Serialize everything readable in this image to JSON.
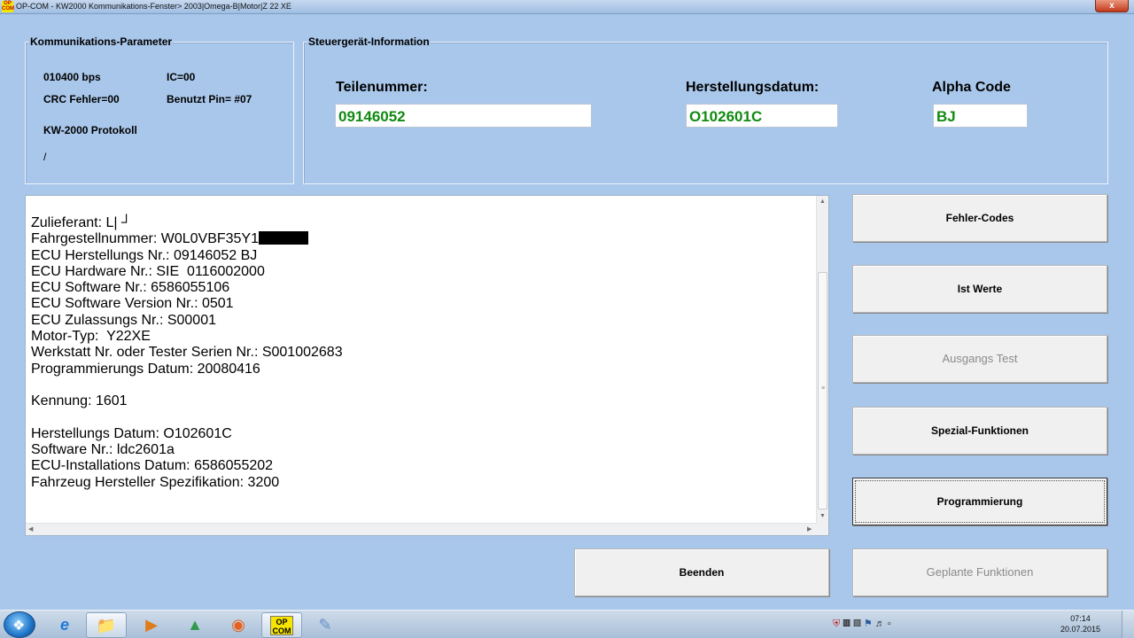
{
  "window": {
    "icon_text": "OP COM",
    "title": "OP-COM - KW2000 Kommunikations-Fenster> 2003|Omega-B|Motor|Z 22 XE",
    "close_label": "x"
  },
  "comm_params": {
    "legend": "Kommunikations-Parameter",
    "baud": "010400 bps",
    "ic": "IC=00",
    "crc": "CRC Fehler=00",
    "pin": "Benutzt Pin= #07",
    "protocol": "KW-2000 Protokoll",
    "slash": "/"
  },
  "ecu_info": {
    "legend": "Steuergerät-Information",
    "part_label": "Teilenummer:",
    "part_value": "09146052",
    "date_label": "Herstellungsdatum:",
    "date_value": "O102601C",
    "alpha_label": "Alpha Code",
    "alpha_value": "BJ"
  },
  "info": {
    "lines": [
      "Zulieferant: L| ┘",
      "Fahrgestellnummer: W0L0VBF35Y1",
      "ECU Herstellungs Nr.: 09146052 BJ",
      "ECU Hardware Nr.: SIE  0116002000",
      "ECU Software Nr.: 6586055106",
      "ECU Software Version Nr.: 0501",
      "ECU Zulassungs Nr.: S00001",
      "Motor-Typ:  Y22XE",
      "Werkstatt Nr. oder Tester Serien Nr.: S001002683",
      "Programmierungs Datum: 20080416",
      "",
      "Kennung: 1601",
      "",
      "Herstellungs Datum: O102601C",
      "Software Nr.: ldc2601a",
      "ECU-Installations Datum: 6586055202",
      "Fahrzeug Hersteller Spezifikation: 3200"
    ]
  },
  "buttons": {
    "fehler_codes": "Fehler-Codes",
    "ist_werte": "Ist Werte",
    "ausgangs_test": "Ausgangs Test",
    "spezial_funktionen": "Spezial-Funktionen",
    "programmierung": "Programmierung",
    "beenden": "Beenden",
    "geplante_funktionen": "Geplante Funktionen"
  },
  "taskbar": {
    "opcom_label": "OP COM",
    "tray_icons": [
      "shield-icon",
      "windows-flag-icon",
      "network-icon",
      "volume-icon"
    ],
    "time": "07:14",
    "date": "20.07.2015"
  }
}
